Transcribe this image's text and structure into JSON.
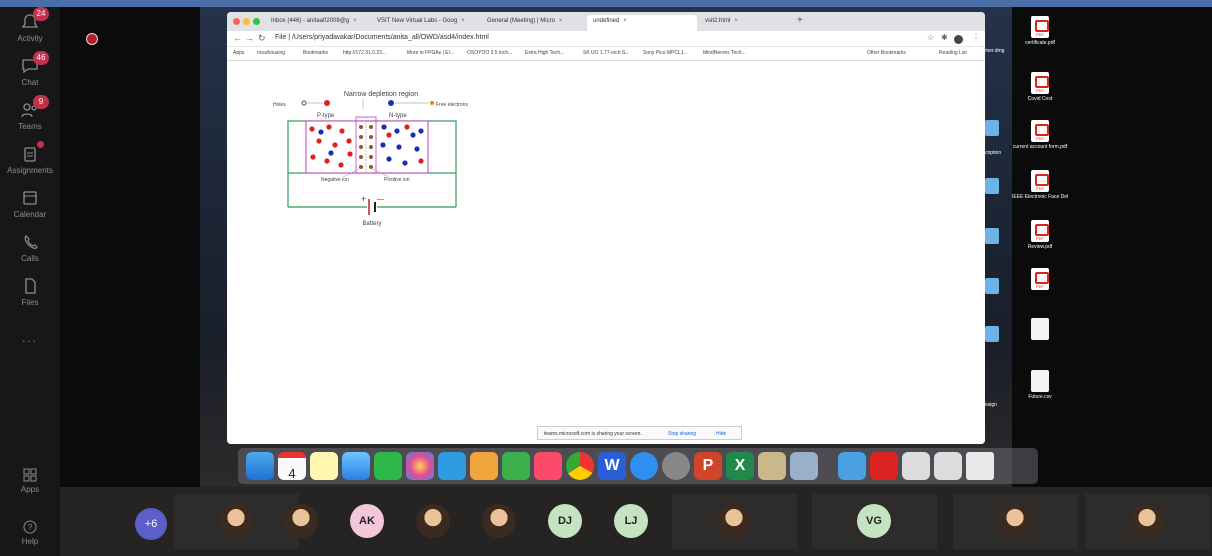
{
  "teams_rail": {
    "items": [
      {
        "label": "Activity",
        "badge": "24",
        "icon": "bell-icon"
      },
      {
        "label": "Chat",
        "badge": "46",
        "icon": "chat-icon"
      },
      {
        "label": "Teams",
        "badge": "9",
        "icon": "teams-icon"
      },
      {
        "label": "Assignments",
        "badge": "",
        "icon": "assignments-icon"
      },
      {
        "label": "Calendar",
        "badge": "",
        "icon": "calendar-icon"
      },
      {
        "label": "Calls",
        "badge": "",
        "icon": "phone-icon"
      },
      {
        "label": "Files",
        "badge": "",
        "icon": "file-icon"
      }
    ],
    "more": "...",
    "apps_label": "Apps",
    "help_label": "Help"
  },
  "browser": {
    "tabs": [
      {
        "label": "Inbox (446) - anitaa02008@g"
      },
      {
        "label": "VSIT New Virtual Labs - Goog"
      },
      {
        "label": "General (Meeting) | Micro"
      },
      {
        "label": "undefined"
      },
      {
        "label": "vsit2.html"
      }
    ],
    "url": "File | /Users/priyadiwakar/Documents/anita_all/OWD/asd4/index.html",
    "bookmarks": [
      "Apps",
      "ncsuhousing",
      "Bookmarks",
      "http://172.31.0.23...",
      "More in FPGAs | El...",
      "OSOYOO 3.5 inch...",
      "Extra High Tech...",
      "SK UO 1.77-inch S...",
      "Sony Pico MPCL1...",
      "MindNerves Tech..."
    ],
    "other_bookmarks": "Other Bookmarks",
    "reading_list": "Reading List",
    "sharing_text": "teams.microsoft.com is sharing your screen.",
    "stop_sharing": "Stop sharing",
    "hide": "Hide"
  },
  "diagram": {
    "title": "Narrow depletion region",
    "holes": "Holes",
    "free_electrons": "Free electrons",
    "p_type": "P-type",
    "n_type": "N-type",
    "negative_ion": "Negative ion",
    "positive_ion": "Positive ion",
    "battery": "Battery",
    "plus": "+",
    "minus": "—"
  },
  "desktop_icons": [
    {
      "label": "certificate.pdf"
    },
    {
      "label": "Covid Cost"
    },
    {
      "label": "current account form.pdf"
    },
    {
      "label": "IEEE Electronic Face Defect.pdf"
    },
    {
      "label": "Review.pdf"
    },
    {
      "label": "Future.csv"
    }
  ],
  "desktop_partial_labels": [
    "mer.dmg",
    "cription",
    "esign"
  ],
  "participants": [
    {
      "initials": "+6",
      "photo": false,
      "color": "#5b5fc7"
    },
    {
      "initials": "",
      "photo": true,
      "color": "#e9c29a"
    },
    {
      "initials": "",
      "photo": true,
      "color": "#e9c29a"
    },
    {
      "initials": "AK",
      "photo": false,
      "color": "#f4c6d9"
    },
    {
      "initials": "",
      "photo": true,
      "color": "#e9c29a"
    },
    {
      "initials": "",
      "photo": true,
      "color": "#e9c29a"
    },
    {
      "initials": "DJ",
      "photo": false,
      "color": "#c5e3c2"
    },
    {
      "initials": "LJ",
      "photo": false,
      "color": "#c5e3c2"
    },
    {
      "initials": "",
      "photo": true,
      "color": "#e9c29a"
    },
    {
      "initials": "VG",
      "photo": false,
      "color": "#c5e3c2"
    },
    {
      "initials": "",
      "photo": true,
      "color": "#e9c29a"
    },
    {
      "initials": "",
      "photo": true,
      "color": "#e9c29a"
    }
  ],
  "calendar_dock_day": "4"
}
